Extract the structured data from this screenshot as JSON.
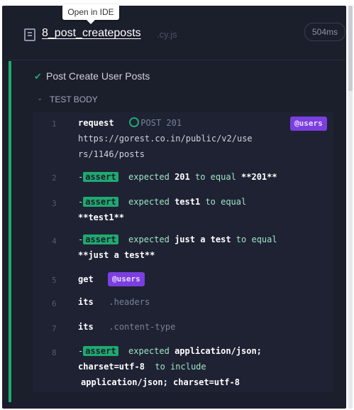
{
  "tooltip": {
    "text": "Open in IDE"
  },
  "spec": {
    "name": "8_post_createposts",
    "ext": ".cy.js",
    "duration": "504ms"
  },
  "test": {
    "title": "Post Create User Posts",
    "section": "TEST BODY"
  },
  "commands": [
    {
      "num": "1",
      "name": "request",
      "status": "POST 201",
      "url1": "https://gorest.co.in/public/v2/use",
      "url2": "rs/1146/posts",
      "alias": "@users"
    },
    {
      "num": "2",
      "dash": "-",
      "badge": "assert",
      "t1": "expected",
      "v1": "201",
      "t2": "to equal",
      "v2": "**201**"
    },
    {
      "num": "3",
      "dash": "-",
      "badge": "assert",
      "t1": "expected",
      "v1": "test1",
      "t2": "to equal",
      "v2": "**test1**"
    },
    {
      "num": "4",
      "dash": "-",
      "badge": "assert",
      "t1": "expected",
      "v1": "just a test",
      "t2": "to equal",
      "v2": "**just a test**"
    },
    {
      "num": "5",
      "name": "get",
      "alias": "@users"
    },
    {
      "num": "6",
      "name": "its",
      "arg": ".headers"
    },
    {
      "num": "7",
      "name": "its",
      "arg": ".content-type"
    },
    {
      "num": "8",
      "dash": "-",
      "badge": "assert",
      "t1": "expected",
      "v1": "application/json;",
      "v1b": "charset=utf-8",
      "t2": "to include",
      "v2": "application/json; charset=utf-8"
    }
  ],
  "colors": {
    "pass": "#1fa971",
    "alias": "#7b3fe0",
    "panel": "#1b1e2b"
  }
}
